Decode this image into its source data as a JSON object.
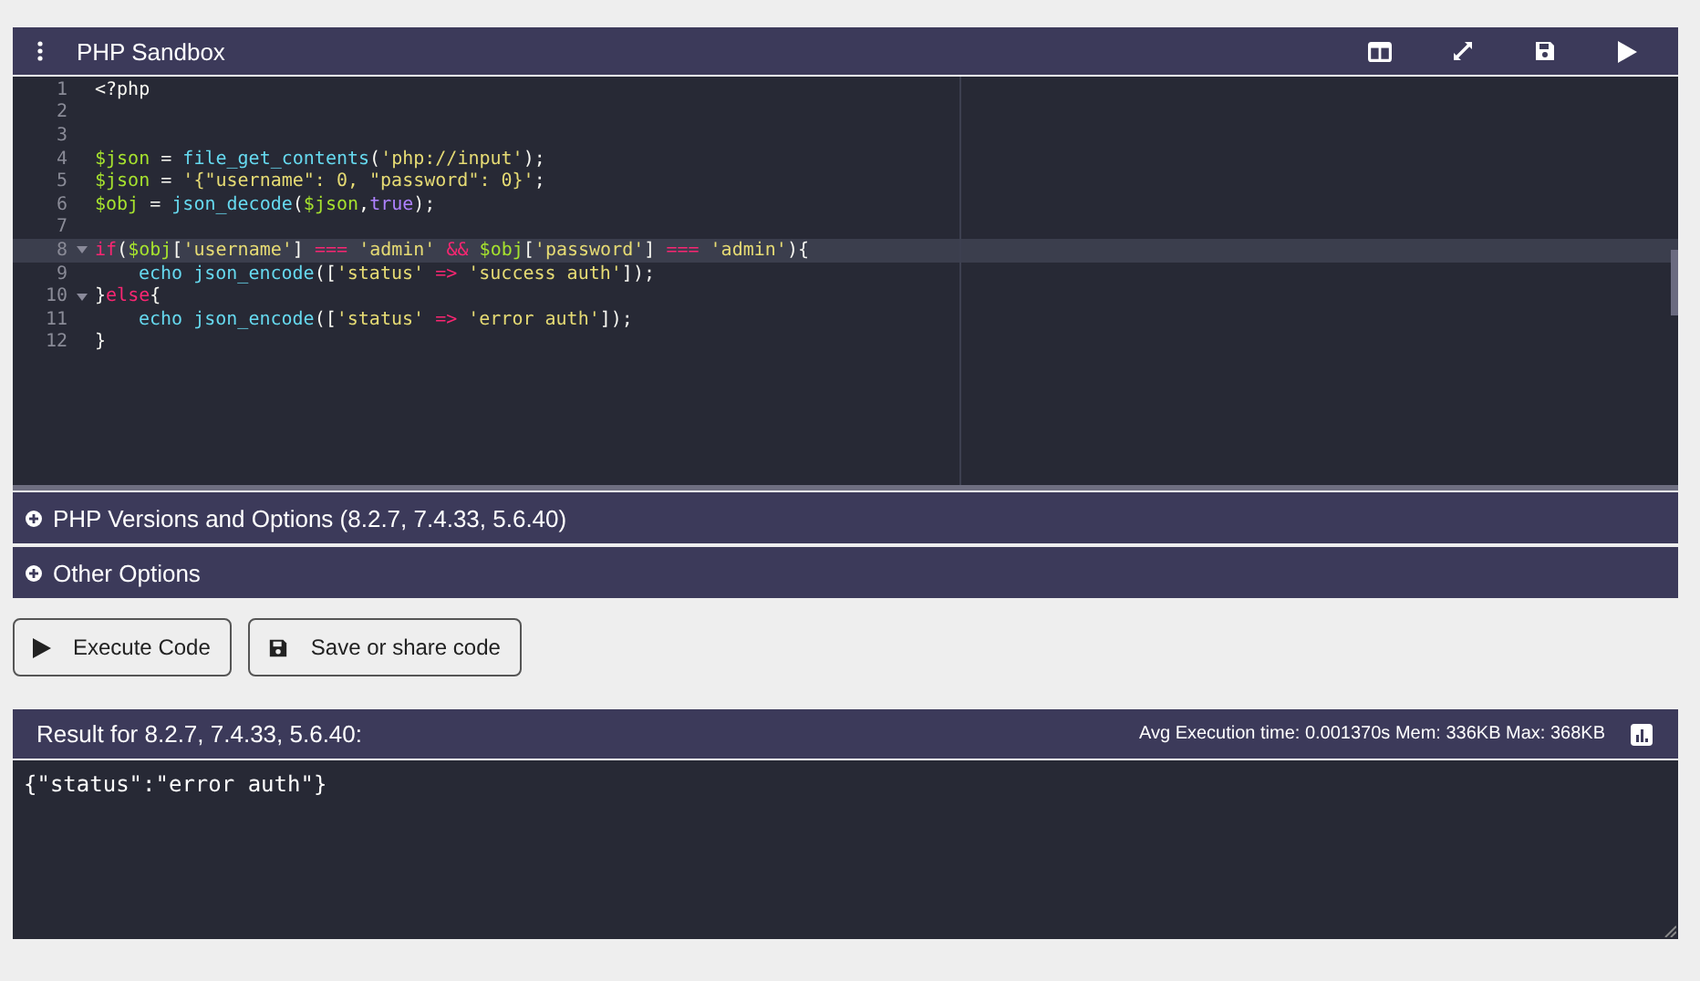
{
  "header": {
    "title": "PHP Sandbox"
  },
  "editor": {
    "lines": [
      {
        "number": "1",
        "fold": false,
        "active": false,
        "tokens": [
          {
            "kind": "text",
            "text": "<?php"
          }
        ]
      },
      {
        "number": "2",
        "fold": false,
        "active": false
      },
      {
        "number": "3",
        "fold": false,
        "active": false
      },
      {
        "number": "4",
        "fold": false,
        "active": false,
        "tokens": [
          {
            "kind": "var",
            "text": "$json"
          },
          {
            "kind": "text",
            "text": " = "
          },
          {
            "kind": "fn",
            "text": "file_get_contents"
          },
          {
            "kind": "text",
            "text": "("
          },
          {
            "kind": "str",
            "text": "'php://input'"
          },
          {
            "kind": "text",
            "text": ");"
          }
        ]
      },
      {
        "number": "5",
        "fold": false,
        "active": false,
        "tokens": [
          {
            "kind": "var",
            "text": "$json"
          },
          {
            "kind": "text",
            "text": " = "
          },
          {
            "kind": "str",
            "text": "'{\"username\": 0, \"password\": 0}'"
          },
          {
            "kind": "text",
            "text": ";"
          }
        ]
      },
      {
        "number": "6",
        "fold": false,
        "active": false,
        "tokens": [
          {
            "kind": "var",
            "text": "$obj"
          },
          {
            "kind": "text",
            "text": " = "
          },
          {
            "kind": "fn",
            "text": "json_decode"
          },
          {
            "kind": "text",
            "text": "("
          },
          {
            "kind": "var",
            "text": "$json"
          },
          {
            "kind": "text",
            "text": ","
          },
          {
            "kind": "const",
            "text": "true"
          },
          {
            "kind": "text",
            "text": ");"
          }
        ]
      },
      {
        "number": "7",
        "fold": false,
        "active": false
      },
      {
        "number": "8",
        "fold": true,
        "active": true,
        "tokens": [
          {
            "kind": "kw",
            "text": "if"
          },
          {
            "kind": "text",
            "text": "("
          },
          {
            "kind": "var",
            "text": "$obj"
          },
          {
            "kind": "text",
            "text": "["
          },
          {
            "kind": "str",
            "text": "'username'"
          },
          {
            "kind": "text",
            "text": "] "
          },
          {
            "kind": "op",
            "text": "=== "
          },
          {
            "kind": "str",
            "text": "'admin' "
          },
          {
            "kind": "op",
            "text": "&& "
          },
          {
            "kind": "var",
            "text": "$obj"
          },
          {
            "kind": "text",
            "text": "["
          },
          {
            "kind": "str",
            "text": "'password'"
          },
          {
            "kind": "text",
            "text": "] "
          },
          {
            "kind": "op",
            "text": "=== "
          },
          {
            "kind": "str",
            "text": "'admin'"
          },
          {
            "kind": "text",
            "text": "){"
          }
        ]
      },
      {
        "number": "9",
        "fold": false,
        "active": false,
        "indented": true,
        "tokens": [
          {
            "kind": "fn",
            "text": "echo json_encode"
          },
          {
            "kind": "text",
            "text": "(["
          },
          {
            "kind": "str",
            "text": "'status' "
          },
          {
            "kind": "op",
            "text": "=> "
          },
          {
            "kind": "str",
            "text": "'success auth'"
          },
          {
            "kind": "text",
            "text": "]);"
          }
        ]
      },
      {
        "number": "10",
        "fold": true,
        "active": false,
        "tokens": [
          {
            "kind": "text",
            "text": "}"
          },
          {
            "kind": "kw",
            "text": "else"
          },
          {
            "kind": "text",
            "text": "{"
          }
        ]
      },
      {
        "number": "11",
        "fold": false,
        "active": false,
        "indented": true,
        "tokens": [
          {
            "kind": "fn",
            "text": "echo json_encode"
          },
          {
            "kind": "text",
            "text": "(["
          },
          {
            "kind": "str",
            "text": "'status' "
          },
          {
            "kind": "op",
            "text": "=> "
          },
          {
            "kind": "str",
            "text": "'error auth'"
          },
          {
            "kind": "text",
            "text": "]);"
          }
        ]
      },
      {
        "number": "12",
        "fold": false,
        "active": false,
        "tokens": [
          {
            "kind": "text",
            "text": "}"
          }
        ]
      }
    ]
  },
  "sections": [
    {
      "label": "PHP Versions and Options (8.2.7, 7.4.33, 5.6.40)",
      "expanded": false
    },
    {
      "label": "Other Options",
      "expanded": false
    }
  ],
  "buttons": [
    {
      "kind": "run",
      "label": "Execute Code"
    },
    {
      "kind": "save",
      "label": "Save or share code"
    }
  ],
  "result": {
    "title": "Result for 8.2.7, 7.4.33, 5.6.40:",
    "stats": "Avg Execution time: 0.001370s Mem: 336KB Max: 368KB",
    "output": "{\"status\":\"error auth\"}"
  }
}
